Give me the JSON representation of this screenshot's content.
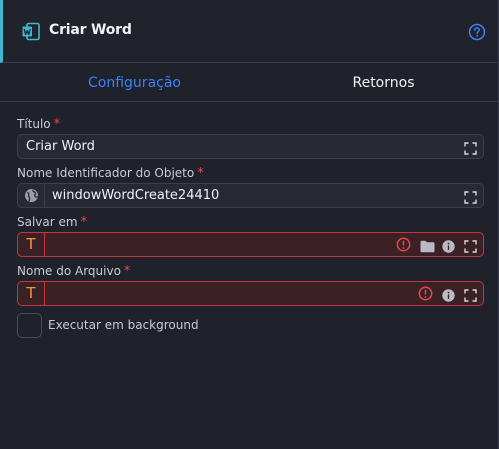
{
  "header": {
    "title": "Criar Word",
    "icon": "word-document-icon",
    "accent_color": "#3fb8d0"
  },
  "tabs": [
    {
      "label": "Configuração",
      "active": true,
      "color": "#3a82f6"
    },
    {
      "label": "Retornos",
      "active": false
    }
  ],
  "fields": {
    "titulo": {
      "label": "Título",
      "required": true,
      "value": "Criar Word"
    },
    "nome_objeto": {
      "label": "Nome Identificador do Objeto",
      "required": true,
      "value": "windowWordCreate24410"
    },
    "salvar_em": {
      "label": "Salvar em",
      "required": true,
      "value": "",
      "type_badge": "T",
      "error": true
    },
    "nome_arquivo": {
      "label": "Nome do Arquivo",
      "required": true,
      "value": "",
      "type_badge": "T",
      "error": true
    }
  },
  "required_marker": "*",
  "background_option": {
    "label": "Executar em background",
    "checked": false
  },
  "colors": {
    "error": "#e5484d",
    "badge": "#f1993a"
  }
}
